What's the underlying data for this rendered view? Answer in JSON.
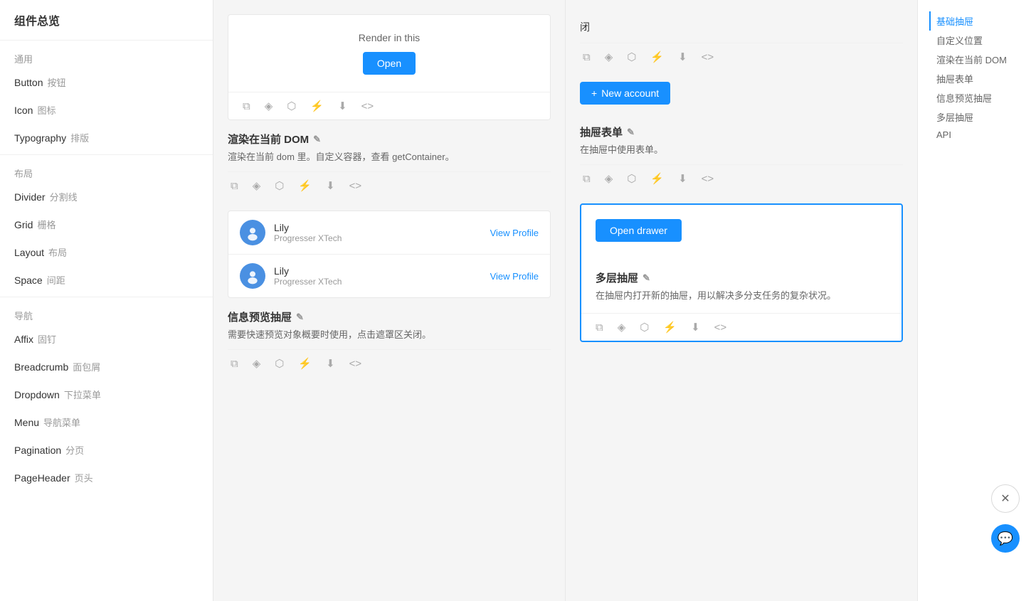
{
  "sidebar": {
    "title": "组件总览",
    "sections": [
      {
        "label": "通用",
        "items": [
          {
            "id": "button",
            "en": "Button",
            "zh": "按钮"
          },
          {
            "id": "icon",
            "en": "Icon",
            "zh": "图标"
          },
          {
            "id": "typography",
            "en": "Typography",
            "zh": "排版"
          }
        ]
      },
      {
        "label": "布局",
        "items": [
          {
            "id": "divider",
            "en": "Divider",
            "zh": "分割线"
          },
          {
            "id": "grid",
            "en": "Grid",
            "zh": "栅格"
          },
          {
            "id": "layout",
            "en": "Layout",
            "zh": "布局"
          },
          {
            "id": "space",
            "en": "Space",
            "zh": "间距"
          }
        ]
      },
      {
        "label": "导航",
        "items": [
          {
            "id": "affix",
            "en": "Affix",
            "zh": "固钉"
          },
          {
            "id": "breadcrumb",
            "en": "Breadcrumb",
            "zh": "面包屑"
          },
          {
            "id": "dropdown",
            "en": "Dropdown",
            "zh": "下拉菜单"
          },
          {
            "id": "menu",
            "en": "Menu",
            "zh": "导航菜单"
          },
          {
            "id": "pagination",
            "en": "Pagination",
            "zh": "分页"
          },
          {
            "id": "pageheader",
            "en": "PageHeader",
            "zh": "页头"
          }
        ]
      }
    ]
  },
  "right_nav": {
    "items": [
      {
        "id": "basic-drawer",
        "label": "基础抽屉",
        "active": true
      },
      {
        "id": "custom-placement",
        "label": "自定义位置",
        "active": false
      },
      {
        "id": "render-current-dom",
        "label": "渲染在当前 DOM",
        "active": false
      },
      {
        "id": "drawer-form",
        "label": "抽屉表单",
        "active": false
      },
      {
        "id": "info-drawer",
        "label": "信息预览抽屉",
        "active": false
      },
      {
        "id": "multi-drawer",
        "label": "多层抽屉",
        "active": false
      },
      {
        "id": "api",
        "label": "API",
        "active": false
      }
    ]
  },
  "left_col": {
    "sections": [
      {
        "id": "render-in-this",
        "demo_text": "Render in this",
        "open_btn": "Open",
        "icons": [
          "copy",
          "codepen",
          "codesandbox",
          "stackblitz",
          "download",
          "code"
        ]
      },
      {
        "id": "render-current-dom-section",
        "title": "渲染在当前 DOM",
        "edit_icon": true,
        "description": "渲染在当前 dom 里。自定义容器，查看 getContainer。",
        "icons": [
          "copy",
          "codepen",
          "codesandbox",
          "stackblitz",
          "download",
          "code"
        ]
      },
      {
        "id": "info-preview-section",
        "title": "信息预览抽屉",
        "edit_icon": true,
        "description": "需要快速预览对象概要时使用，点击遮罩区关闭。",
        "user_items": [
          {
            "name": "Lily",
            "company": "Progresser XTech",
            "action": "View Profile"
          },
          {
            "name": "Lily",
            "company": "Progresser XTech",
            "action": "View Profile"
          }
        ],
        "icons": [
          "copy",
          "codepen",
          "codesandbox",
          "stackblitz",
          "download",
          "code"
        ]
      }
    ]
  },
  "right_col": {
    "sections": [
      {
        "id": "closed-section",
        "closed_text": "闭",
        "new_account_btn": "+ New account",
        "icons_top": [
          "copy",
          "codepen",
          "codesandbox",
          "stackblitz",
          "download",
          "code"
        ],
        "icons_bottom": [
          "copy",
          "codepen",
          "codesandbox",
          "stackblitz",
          "download",
          "code"
        ]
      },
      {
        "id": "drawer-form-section",
        "title": "抽屉表单",
        "edit_icon": true,
        "description": "在抽屉中使用表单。",
        "icons": [
          "copy",
          "codepen",
          "codesandbox",
          "stackblitz",
          "download",
          "code"
        ]
      },
      {
        "id": "multi-drawer-section",
        "title": "多层抽屉",
        "edit_icon": true,
        "description": "在抽屉内打开新的抽屉，用以解决多分支任务的复杂状况。",
        "open_drawer_btn": "Open drawer",
        "icons": [
          "copy",
          "codepen",
          "codesandbox",
          "stackblitz",
          "download",
          "code"
        ],
        "highlighted": true
      }
    ]
  },
  "floating": {
    "tools_icon": "✕",
    "chat_icon": "💬"
  },
  "icons": {
    "copy": "⧉",
    "codepen": "◈",
    "codesandbox": "⬡",
    "stackblitz": "⚡",
    "download": "⬇",
    "code": "<>",
    "edit": "✎",
    "plus": "+"
  }
}
